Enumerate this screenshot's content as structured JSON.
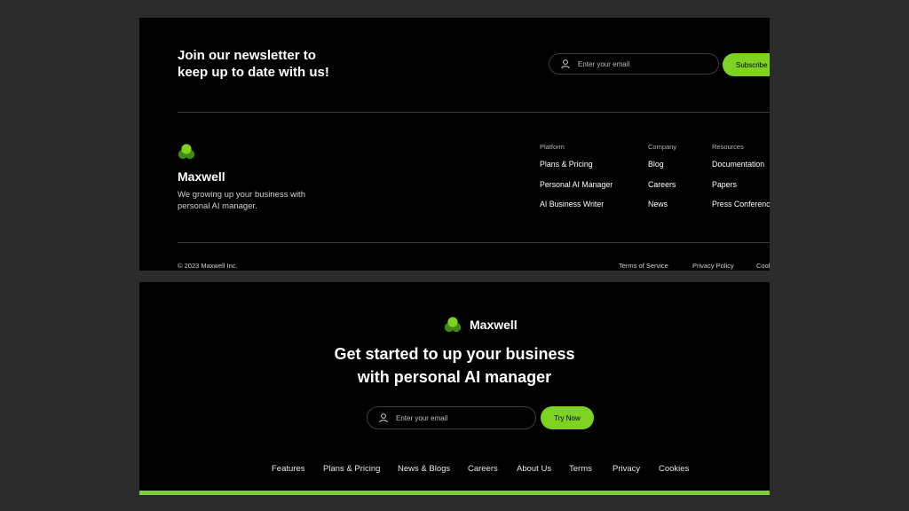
{
  "colors": {
    "accent": "#7ed321",
    "panel_bg": "#000000",
    "page_bg": "#2b2b2b"
  },
  "newsletter": {
    "title_line1": "Join our newsletter to",
    "title_line2": "keep up to date with us!",
    "email_placeholder": "Enter your email",
    "subscribe_label": "Subscribe",
    "icon": "user-icon"
  },
  "brand": {
    "name": "Maxwell",
    "logo_icon": "maxwell-logo-icon",
    "tagline_line1": "We growing up your business with",
    "tagline_line2": "personal AI manager."
  },
  "footer_columns": [
    {
      "heading": "Platform",
      "items": [
        "Plans & Pricing",
        "Personal AI Manager",
        "AI Business Writer"
      ]
    },
    {
      "heading": "Company",
      "items": [
        "Blog",
        "Careers",
        "News"
      ]
    },
    {
      "heading": "Resources",
      "items": [
        "Documentation",
        "Papers",
        "Press Conference"
      ]
    }
  ],
  "copyright": "© 2023 Maxwell Inc.",
  "legal_links": [
    "Terms of Service",
    "Privacy Policy",
    "Cookies"
  ],
  "cta": {
    "brand_name": "Maxwell",
    "headline_line1": "Get started to up your business",
    "headline_line2": "with personal AI manager",
    "email_placeholder": "Enter your email",
    "button_label": "Try Now"
  },
  "bottom_nav": [
    "Features",
    "Plans & Pricing",
    "News & Blogs",
    "Careers",
    "About Us",
    "Terms",
    "Privacy",
    "Cookies"
  ]
}
